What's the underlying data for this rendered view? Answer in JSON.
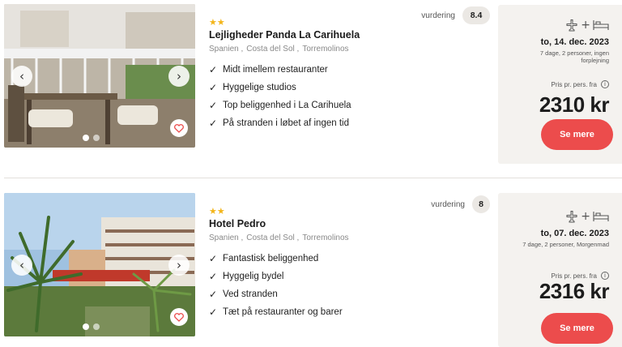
{
  "hotels": [
    {
      "stars": "★★",
      "name": "Lejligheder Panda La Carihuela",
      "location": [
        "Spanien",
        "Costa del Sol",
        "Torremolinos"
      ],
      "features": [
        "Midt imellem restauranter",
        "Hyggelige studios",
        "Top beliggenhed i La Carihuela",
        "På stranden i løbet af ingen tid"
      ],
      "rating_label": "vurdering",
      "rating": "8.4",
      "date": "to, 14. dec. 2023",
      "details": "7 dage, 2 personer, ingen forplejning",
      "price_label": "Pris pr. pers. fra",
      "price": "2310 kr",
      "cta": "Se mere",
      "photo_icons": {
        "prev": "chevron-left-icon",
        "next": "chevron-right-icon",
        "favorite": "heart-icon"
      }
    },
    {
      "stars": "★★",
      "name": "Hotel Pedro",
      "location": [
        "Spanien",
        "Costa del Sol",
        "Torremolinos"
      ],
      "features": [
        "Fantastisk beliggenhed",
        "Hyggelig bydel",
        "Ved stranden",
        "Tæt på restauranter og barer"
      ],
      "rating_label": "vurdering",
      "rating": "8",
      "date": "to, 07. dec. 2023",
      "details": "7 dage, 2 personer, Morgenmad",
      "price_label": "Pris pr. pers. fra",
      "price": "2316 kr",
      "cta": "Se mere",
      "photo_icons": {
        "prev": "chevron-left-icon",
        "next": "chevron-right-icon",
        "favorite": "heart-icon"
      }
    }
  ],
  "icons": {
    "flight": "airplane-icon",
    "hotel": "bed-icon",
    "info": "info-icon",
    "check": "checkmark-icon"
  },
  "colors": {
    "accent": "#ec4c4c",
    "stars": "#f3b51a",
    "panel": "#f4f2ef"
  }
}
